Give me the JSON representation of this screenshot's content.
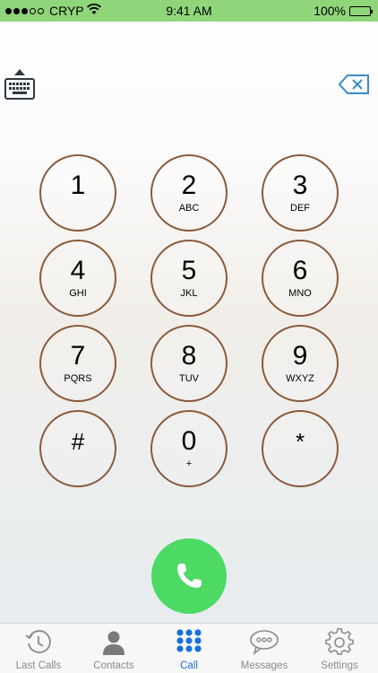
{
  "status_bar": {
    "carrier": "CRYP",
    "time": "9:41 AM",
    "battery": "100%",
    "signal_filled": 3,
    "signal_total": 5
  },
  "icons": {
    "keyboard": "keyboard-icon",
    "backspace": "backspace-icon",
    "call": "phone-icon"
  },
  "keypad": [
    {
      "digit": "1",
      "letters": ""
    },
    {
      "digit": "2",
      "letters": "ABC"
    },
    {
      "digit": "3",
      "letters": "DEF"
    },
    {
      "digit": "4",
      "letters": "GHI"
    },
    {
      "digit": "5",
      "letters": "JKL"
    },
    {
      "digit": "6",
      "letters": "MNO"
    },
    {
      "digit": "7",
      "letters": "PQRS"
    },
    {
      "digit": "8",
      "letters": "TUV"
    },
    {
      "digit": "9",
      "letters": "WXYZ"
    },
    {
      "digit": "#",
      "letters": ""
    },
    {
      "digit": "0",
      "letters": "+"
    },
    {
      "digit": "*",
      "letters": ""
    }
  ],
  "tabbar": [
    {
      "label": "Last Calls",
      "icon": "clock-icon",
      "active": false
    },
    {
      "label": "Contacts",
      "icon": "person-icon",
      "active": false
    },
    {
      "label": "Call",
      "icon": "keypad-grid-icon",
      "active": true
    },
    {
      "label": "Messages",
      "icon": "speech-bubble-icon",
      "active": false
    },
    {
      "label": "Settings",
      "icon": "gear-icon",
      "active": false
    }
  ],
  "colors": {
    "status_bar_bg": "#8fd67a",
    "key_ring": "#8a5a3c",
    "call_button": "#4cd964",
    "tab_active": "#1a6fd6",
    "tab_inactive": "#8a8a8a"
  }
}
